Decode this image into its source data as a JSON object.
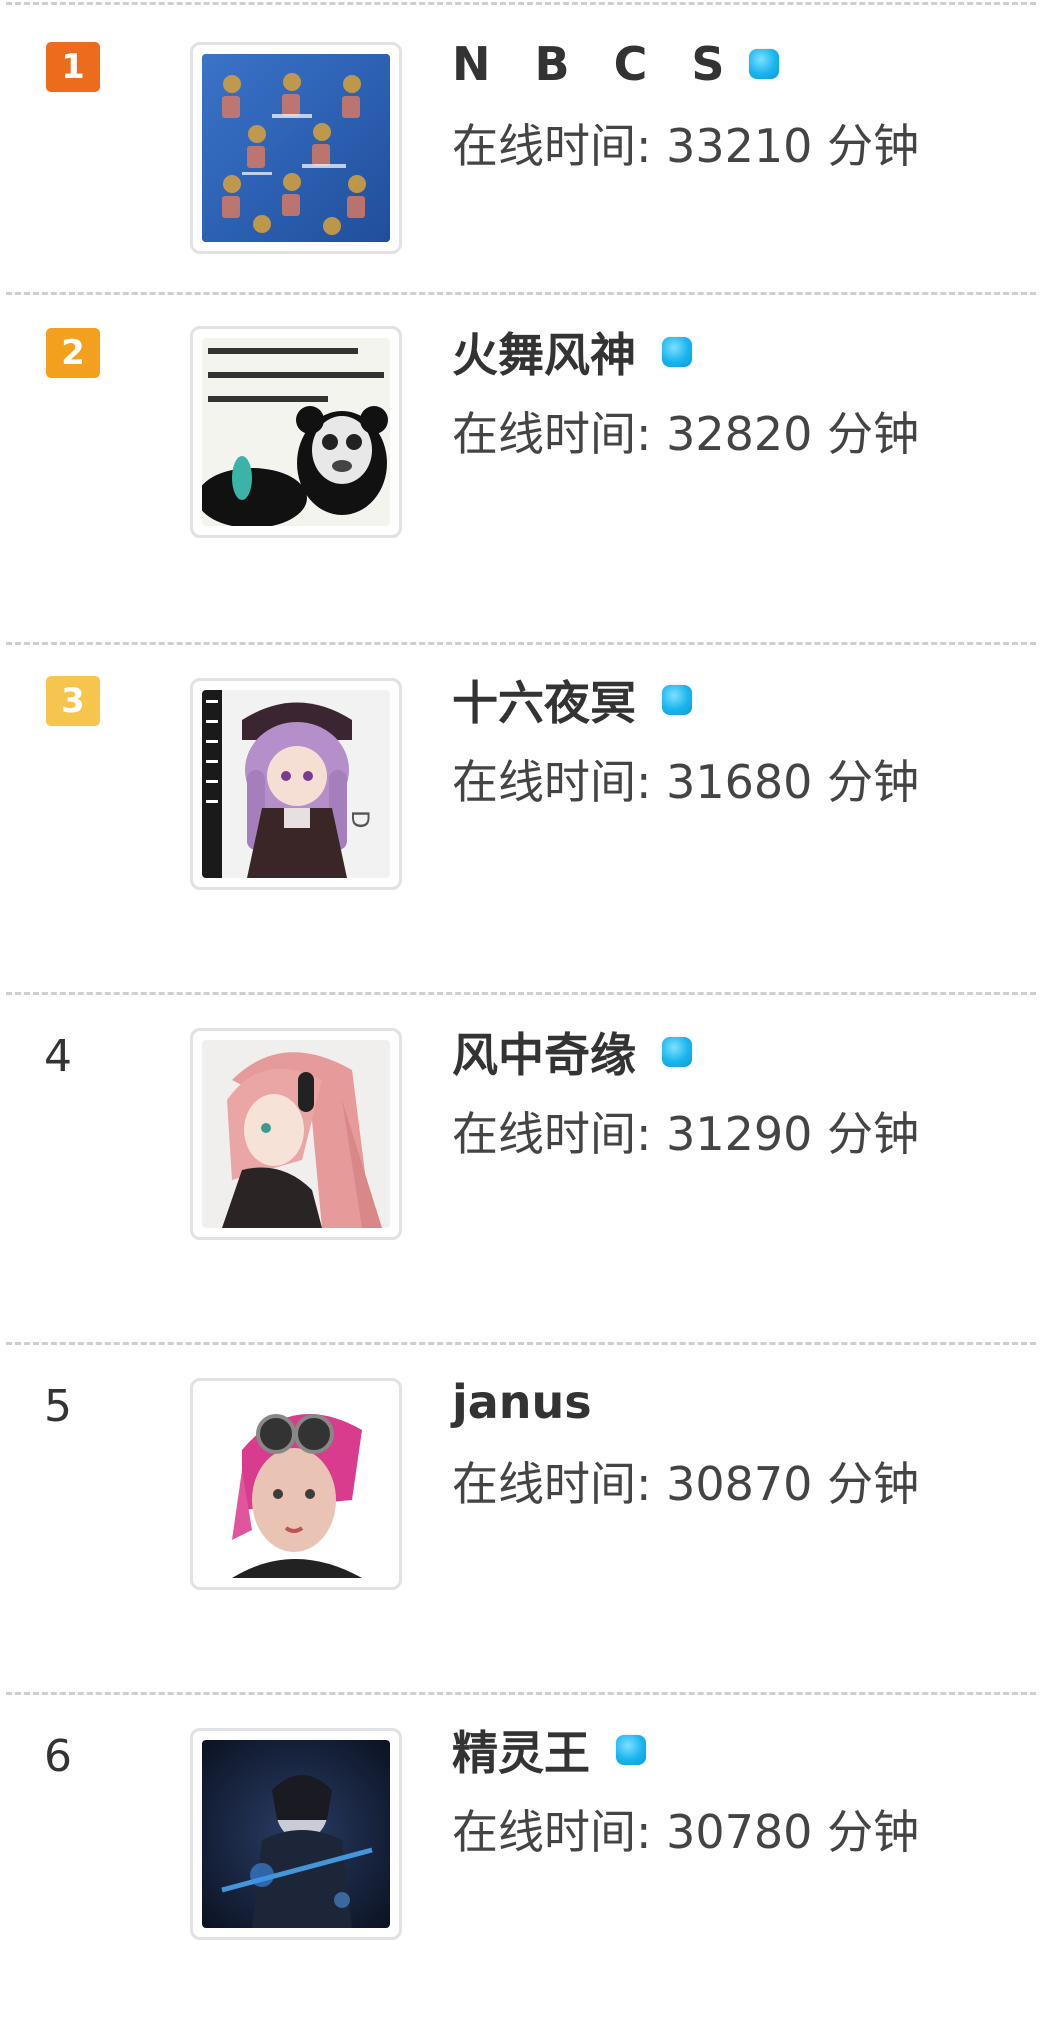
{
  "colors": {
    "rank1": "#ec6b1c",
    "rank2": "#f2a01e",
    "rank3": "#f6c54e",
    "online": "#18b4ee",
    "divider": "#cfcfcf"
  },
  "rows": [
    {
      "rank": "1",
      "name": "N B C S",
      "online": true,
      "time_label": "在线时间: 33210 分钟",
      "avatar": "blue-pattern-avatar"
    },
    {
      "rank": "2",
      "name": "火舞风神",
      "online": true,
      "time_label": "在线时间: 32820 分钟",
      "avatar": "panda-meme-avatar"
    },
    {
      "rank": "3",
      "name": "十六夜冥",
      "online": true,
      "time_label": "在线时间: 31680 分钟",
      "avatar": "anime-girl-purple-avatar"
    },
    {
      "rank": "4",
      "name": "风中奇缘",
      "online": true,
      "time_label": "在线时间: 31290 分钟",
      "avatar": "anime-girl-pink-hair-avatar"
    },
    {
      "rank": "5",
      "name": "janus",
      "online": false,
      "time_label": "在线时间: 30870 分钟",
      "avatar": "pink-hair-goggles-avatar"
    },
    {
      "rank": "6",
      "name": "精灵王",
      "online": true,
      "time_label": "在线时间: 30780 分钟",
      "avatar": "dark-warrior-avatar"
    }
  ]
}
